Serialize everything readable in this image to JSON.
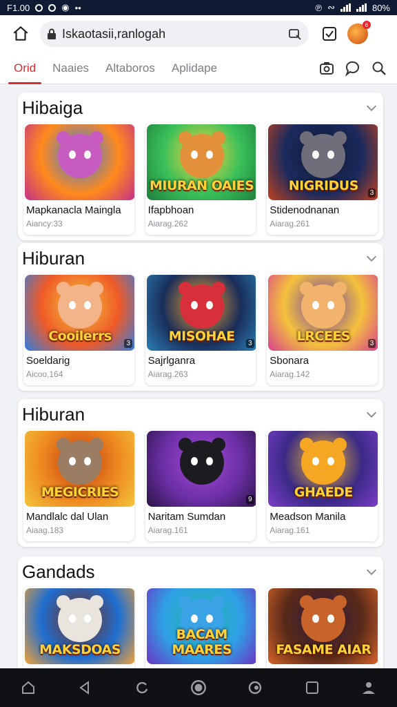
{
  "status_bar": {
    "time": "F1.00",
    "battery": "80%"
  },
  "browser": {
    "url": "Iskaotasii,ranlogah",
    "notification_count": "6"
  },
  "tabs": [
    {
      "label": "Orid",
      "active": true
    },
    {
      "label": "Naaies",
      "active": false
    },
    {
      "label": "Altaboros",
      "active": false
    },
    {
      "label": "Aplidape",
      "active": false
    }
  ],
  "tab_icons": [
    "camera-icon",
    "chat-bubble-icon",
    "search-icon"
  ],
  "sections": [
    {
      "title": "Hibaiga",
      "cards": [
        {
          "name": "Mapkanacla Maingla",
          "meta": "Aiancy:33",
          "thumb_title": "",
          "age": "",
          "colors": [
            "#ff8a1c",
            "#c3308a",
            "#3b7de3"
          ],
          "mascot": "#c85bbf"
        },
        {
          "name": "Ifapbhoan",
          "meta": "Aiarag.262",
          "thumb_title": "MIURAN OAIES",
          "age": "",
          "colors": [
            "#39c05a",
            "#1f7e3c",
            "#f8d43c"
          ],
          "mascot": "#e2913a"
        },
        {
          "name": "Stidenodnanan",
          "meta": "Aiarag.261",
          "thumb_title": "NIGRIDUS",
          "age": "3",
          "colors": [
            "#1b2a5e",
            "#c2421d",
            "#101830"
          ],
          "mascot": "#6f6e7a"
        }
      ]
    },
    {
      "title": "Hiburan",
      "cards": [
        {
          "name": "Soeldarig",
          "meta": "Aicoo,164",
          "thumb_title": "Cooilerrs",
          "age": "3",
          "colors": [
            "#f05a28",
            "#2e7de0",
            "#f0c93a"
          ],
          "mascot": "#f3b48a"
        },
        {
          "name": "Sajrlganra",
          "meta": "Aiarag.263",
          "thumb_title": "MISOHAE",
          "age": "3",
          "colors": [
            "#1a2e5a",
            "#2a7fb5",
            "#f2a230"
          ],
          "mascot": "#d8303a"
        },
        {
          "name": "Sbonara",
          "meta": "Aiarag.142",
          "thumb_title": "LRCEES",
          "age": "3",
          "colors": [
            "#f4c23c",
            "#d8408f",
            "#6a3ab0"
          ],
          "mascot": "#f2b46c"
        }
      ]
    },
    {
      "title": "Hiburan",
      "cards": [
        {
          "name": "Mandlalc dal Ulan",
          "meta": "Aiaag.183",
          "thumb_title": "MEGICRIES",
          "age": "",
          "colors": [
            "#ef8a20",
            "#f2c53c",
            "#c23b12"
          ],
          "mascot": "#9a7d63"
        },
        {
          "name": "Naritam Sumdan",
          "meta": "Aiarag.161",
          "thumb_title": "",
          "age": "9",
          "colors": [
            "#6c2fa6",
            "#2b1546",
            "#a34ad6"
          ],
          "mascot": "#1c1c20"
        },
        {
          "name": "Meadson Manila",
          "meta": "Aiarag.161",
          "thumb_title": "GHAEDE",
          "age": "",
          "colors": [
            "#3a2a86",
            "#7c3ec9",
            "#f0b82c"
          ],
          "mascot": "#f5a623"
        }
      ]
    },
    {
      "title": "Gandads",
      "cards": [
        {
          "name": "",
          "meta": "",
          "thumb_title": "MAKSDOAS",
          "age": "",
          "colors": [
            "#1f6ed0",
            "#f2a23a",
            "#7a2b15"
          ],
          "mascot": "#e9e4dd"
        },
        {
          "name": "",
          "meta": "",
          "thumb_title": "BACAM MAARES",
          "age": "",
          "colors": [
            "#2fa0e6",
            "#6a33c2",
            "#1fb7a8"
          ],
          "mascot": "#3aa3e6"
        },
        {
          "name": "",
          "meta": "",
          "thumb_title": "FASAME AIAR",
          "age": "",
          "colors": [
            "#5a2a18",
            "#d9652a",
            "#2b1a40"
          ],
          "mascot": "#c8642a"
        }
      ]
    }
  ],
  "bottom_nav": [
    "home-icon",
    "back-icon",
    "refresh-icon",
    "circle-icon",
    "settings-icon",
    "tabs-icon",
    "profile-icon"
  ]
}
